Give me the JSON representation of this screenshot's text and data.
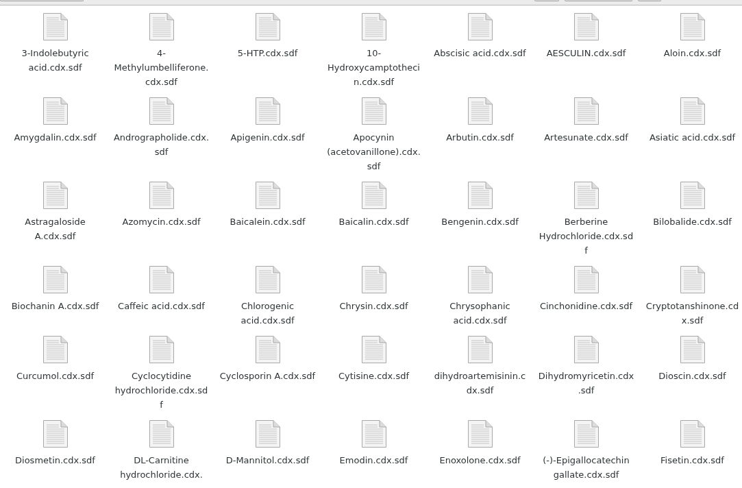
{
  "files": [
    {
      "name": "3-Indolebutyric acid.cdx.sdf"
    },
    {
      "name": "4-Methylumbelliferone.cdx.sdf"
    },
    {
      "name": "5-HTP.cdx.sdf"
    },
    {
      "name": "10-Hydroxycamptothecin.cdx.sdf"
    },
    {
      "name": "Abscisic acid.cdx.sdf"
    },
    {
      "name": "AESCULIN.cdx.sdf"
    },
    {
      "name": "Aloin.cdx.sdf"
    },
    {
      "name": "Amygdalin.cdx.sdf"
    },
    {
      "name": "Andrographolide.cdx.sdf"
    },
    {
      "name": "Apigenin.cdx.sdf"
    },
    {
      "name": "Apocynin (acetovanillone).cdx.sdf"
    },
    {
      "name": "Arbutin.cdx.sdf"
    },
    {
      "name": "Artesunate.cdx.sdf"
    },
    {
      "name": "Asiatic acid.cdx.sdf"
    },
    {
      "name": "Astragaloside A.cdx.sdf"
    },
    {
      "name": "Azomycin.cdx.sdf"
    },
    {
      "name": "Baicalein.cdx.sdf"
    },
    {
      "name": "Baicalin.cdx.sdf"
    },
    {
      "name": "Bengenin.cdx.sdf"
    },
    {
      "name": "Berberine Hydrochloride.cdx.sdf"
    },
    {
      "name": "Bilobalide.cdx.sdf"
    },
    {
      "name": "Biochanin A.cdx.sdf"
    },
    {
      "name": "Caffeic acid.cdx.sdf"
    },
    {
      "name": "Chlorogenic acid.cdx.sdf"
    },
    {
      "name": "Chrysin.cdx.sdf"
    },
    {
      "name": "Chrysophanic acid.cdx.sdf"
    },
    {
      "name": "Cinchonidine.cdx.sdf"
    },
    {
      "name": "Cryptotanshinone.cdx.sdf"
    },
    {
      "name": "Curcumol.cdx.sdf"
    },
    {
      "name": "Cyclocytidine hydrochloride.cdx.sdf"
    },
    {
      "name": "Cyclosporin A.cdx.sdf"
    },
    {
      "name": "Cytisine.cdx.sdf"
    },
    {
      "name": "dihydroartemisinin.cdx.sdf"
    },
    {
      "name": "Dihydromyricetin.cdx.sdf"
    },
    {
      "name": "Dioscin.cdx.sdf"
    },
    {
      "name": "Diosmetin.cdx.sdf"
    },
    {
      "name": "DL-Carnitine hydrochloride.cdx."
    },
    {
      "name": "D-Mannitol.cdx.sdf"
    },
    {
      "name": "Emodin.cdx.sdf"
    },
    {
      "name": "Enoxolone.cdx.sdf"
    },
    {
      "name": "(-)-Epigallocatechin gallate.cdx.sdf"
    },
    {
      "name": "Fisetin.cdx.sdf"
    }
  ]
}
